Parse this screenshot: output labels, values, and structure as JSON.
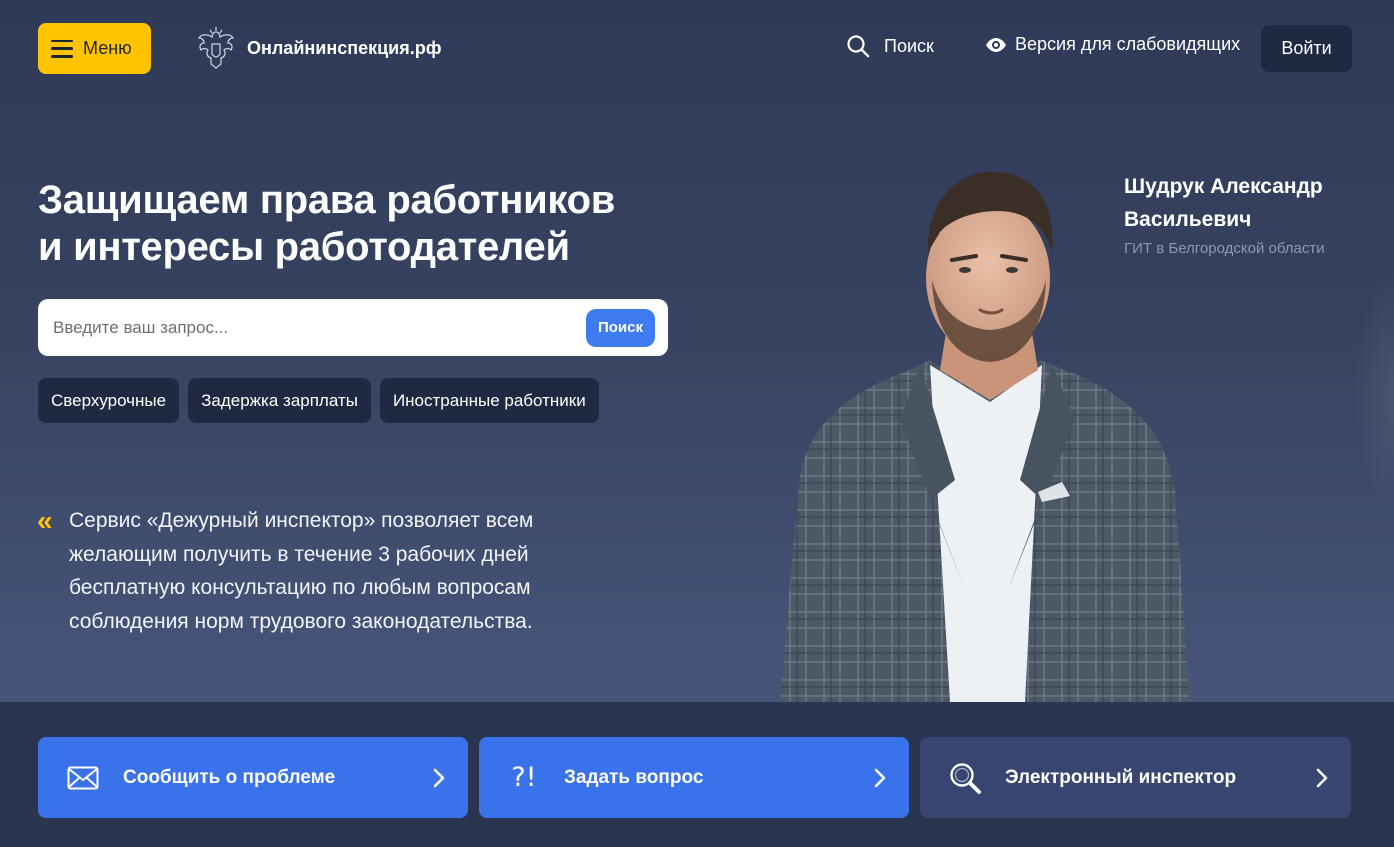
{
  "header": {
    "menu_label": "Меню",
    "site_name": "Онлайнинспекция.рф",
    "search_label": "Поиск",
    "low_vision_label": "Версия для слабовидящих",
    "login_label": "Войти"
  },
  "hero": {
    "headline_line1": "Защищаем права работников",
    "headline_line2": "и интересы работодателей",
    "search_placeholder": "Введите ваш запрос...",
    "search_button": "Поиск",
    "chips": [
      "Сверхурочные",
      "Задержка зарплаты",
      "Иностранные работники"
    ],
    "quote": "Сервис «Дежурный инспектор» позволяет всем желающим получить в течение 3 рабочих дней бесплатную консультацию по любым вопросам соблюдения норм трудового законодательства."
  },
  "person": {
    "name_line1": "Шудрук Александр",
    "name_line2": "Васильевич",
    "org": "ГИТ в Белгородской области"
  },
  "cards": [
    {
      "label": "Сообщить о проблеме",
      "icon": "envelope-icon"
    },
    {
      "label": "Задать вопрос",
      "icon": "question-exclamation-icon"
    },
    {
      "label": "Электронный инспектор",
      "icon": "magnifier-icon"
    }
  ],
  "colors": {
    "accent_yellow": "#ffc300",
    "primary_blue": "#3a72ec",
    "dark_navy": "#1f2a42",
    "card_dark": "#374670"
  }
}
